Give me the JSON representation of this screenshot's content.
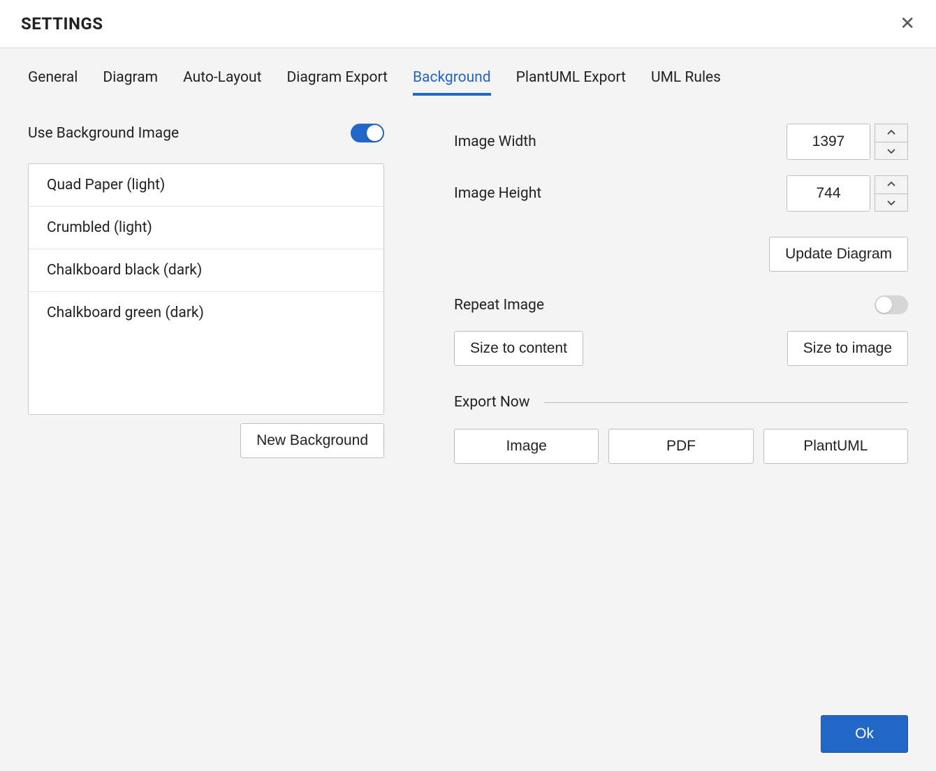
{
  "header": {
    "title": "SETTINGS"
  },
  "tabs": {
    "items": [
      {
        "label": "General",
        "active": false
      },
      {
        "label": "Diagram",
        "active": false
      },
      {
        "label": "Auto-Layout",
        "active": false
      },
      {
        "label": "Diagram Export",
        "active": false
      },
      {
        "label": "Background",
        "active": true
      },
      {
        "label": "PlantUML Export",
        "active": false
      },
      {
        "label": "UML Rules",
        "active": false
      }
    ]
  },
  "background": {
    "use_bg_label": "Use Background Image",
    "use_bg_on": true,
    "list": [
      "Quad Paper (light)",
      "Crumbled (light)",
      "Chalkboard black (dark)",
      "Chalkboard green (dark)"
    ],
    "new_bg_label": "New Background"
  },
  "image": {
    "width_label": "Image Width",
    "width_value": "1397",
    "height_label": "Image Height",
    "height_value": "744",
    "update_label": "Update Diagram",
    "repeat_label": "Repeat Image",
    "repeat_on": false,
    "size_to_content_label": "Size to content",
    "size_to_image_label": "Size to image"
  },
  "export": {
    "section_label": "Export Now",
    "image_label": "Image",
    "pdf_label": "PDF",
    "plantuml_label": "PlantUML"
  },
  "footer": {
    "ok_label": "Ok"
  }
}
